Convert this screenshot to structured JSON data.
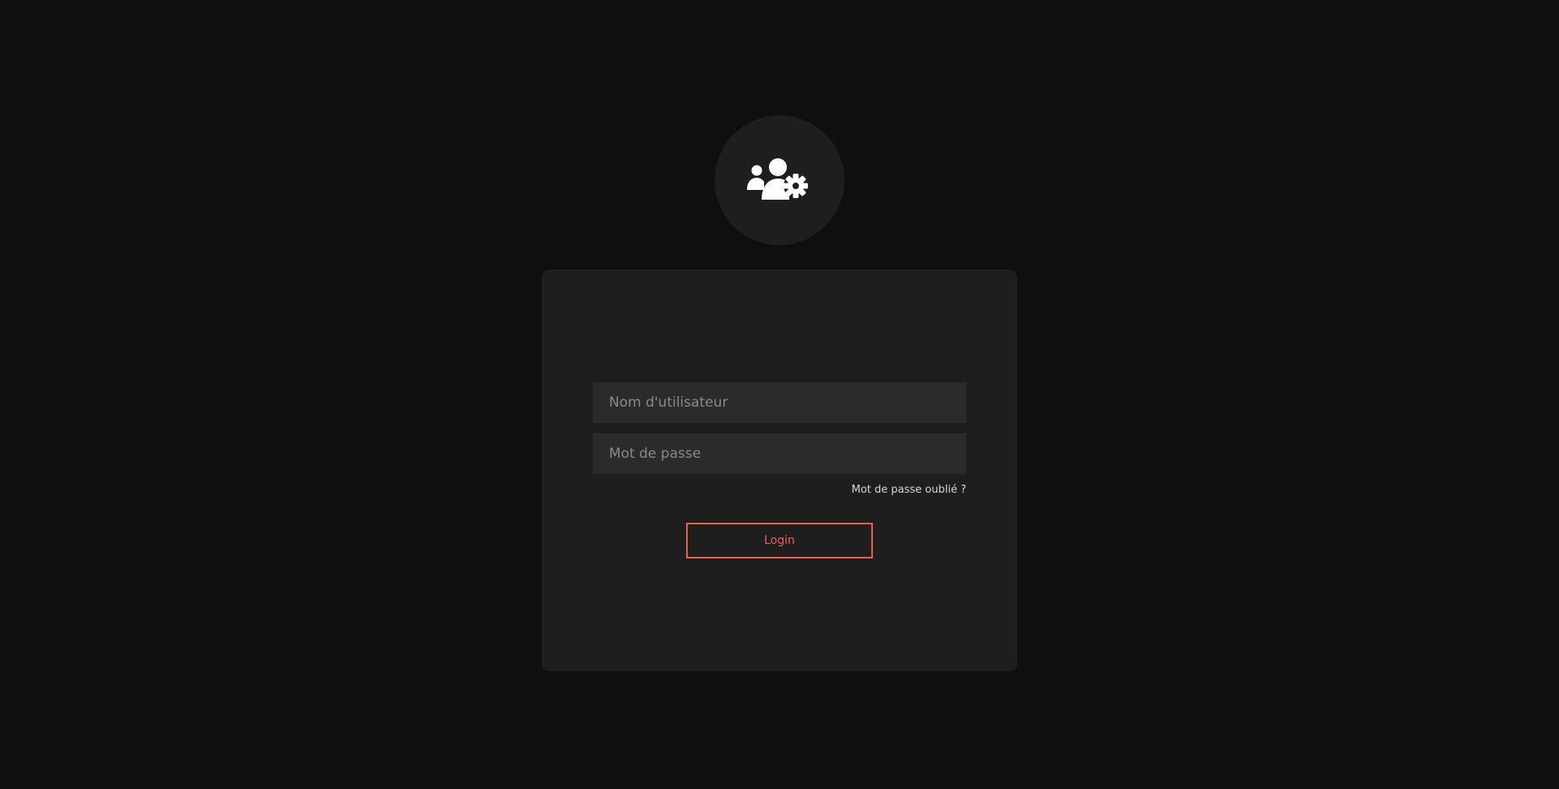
{
  "header": {
    "icon": "users-gear-icon"
  },
  "login_form": {
    "username_placeholder": "Nom d'utilisateur",
    "username_value": "",
    "password_placeholder": "Mot de passe",
    "password_value": "",
    "forgot_password_label": "Mot de passe oublié ?",
    "login_label": "Login"
  },
  "colors": {
    "background": "#0f0f0f",
    "card": "#1e1e1e",
    "input": "#2b2b2b",
    "accent": "#e8614d"
  }
}
